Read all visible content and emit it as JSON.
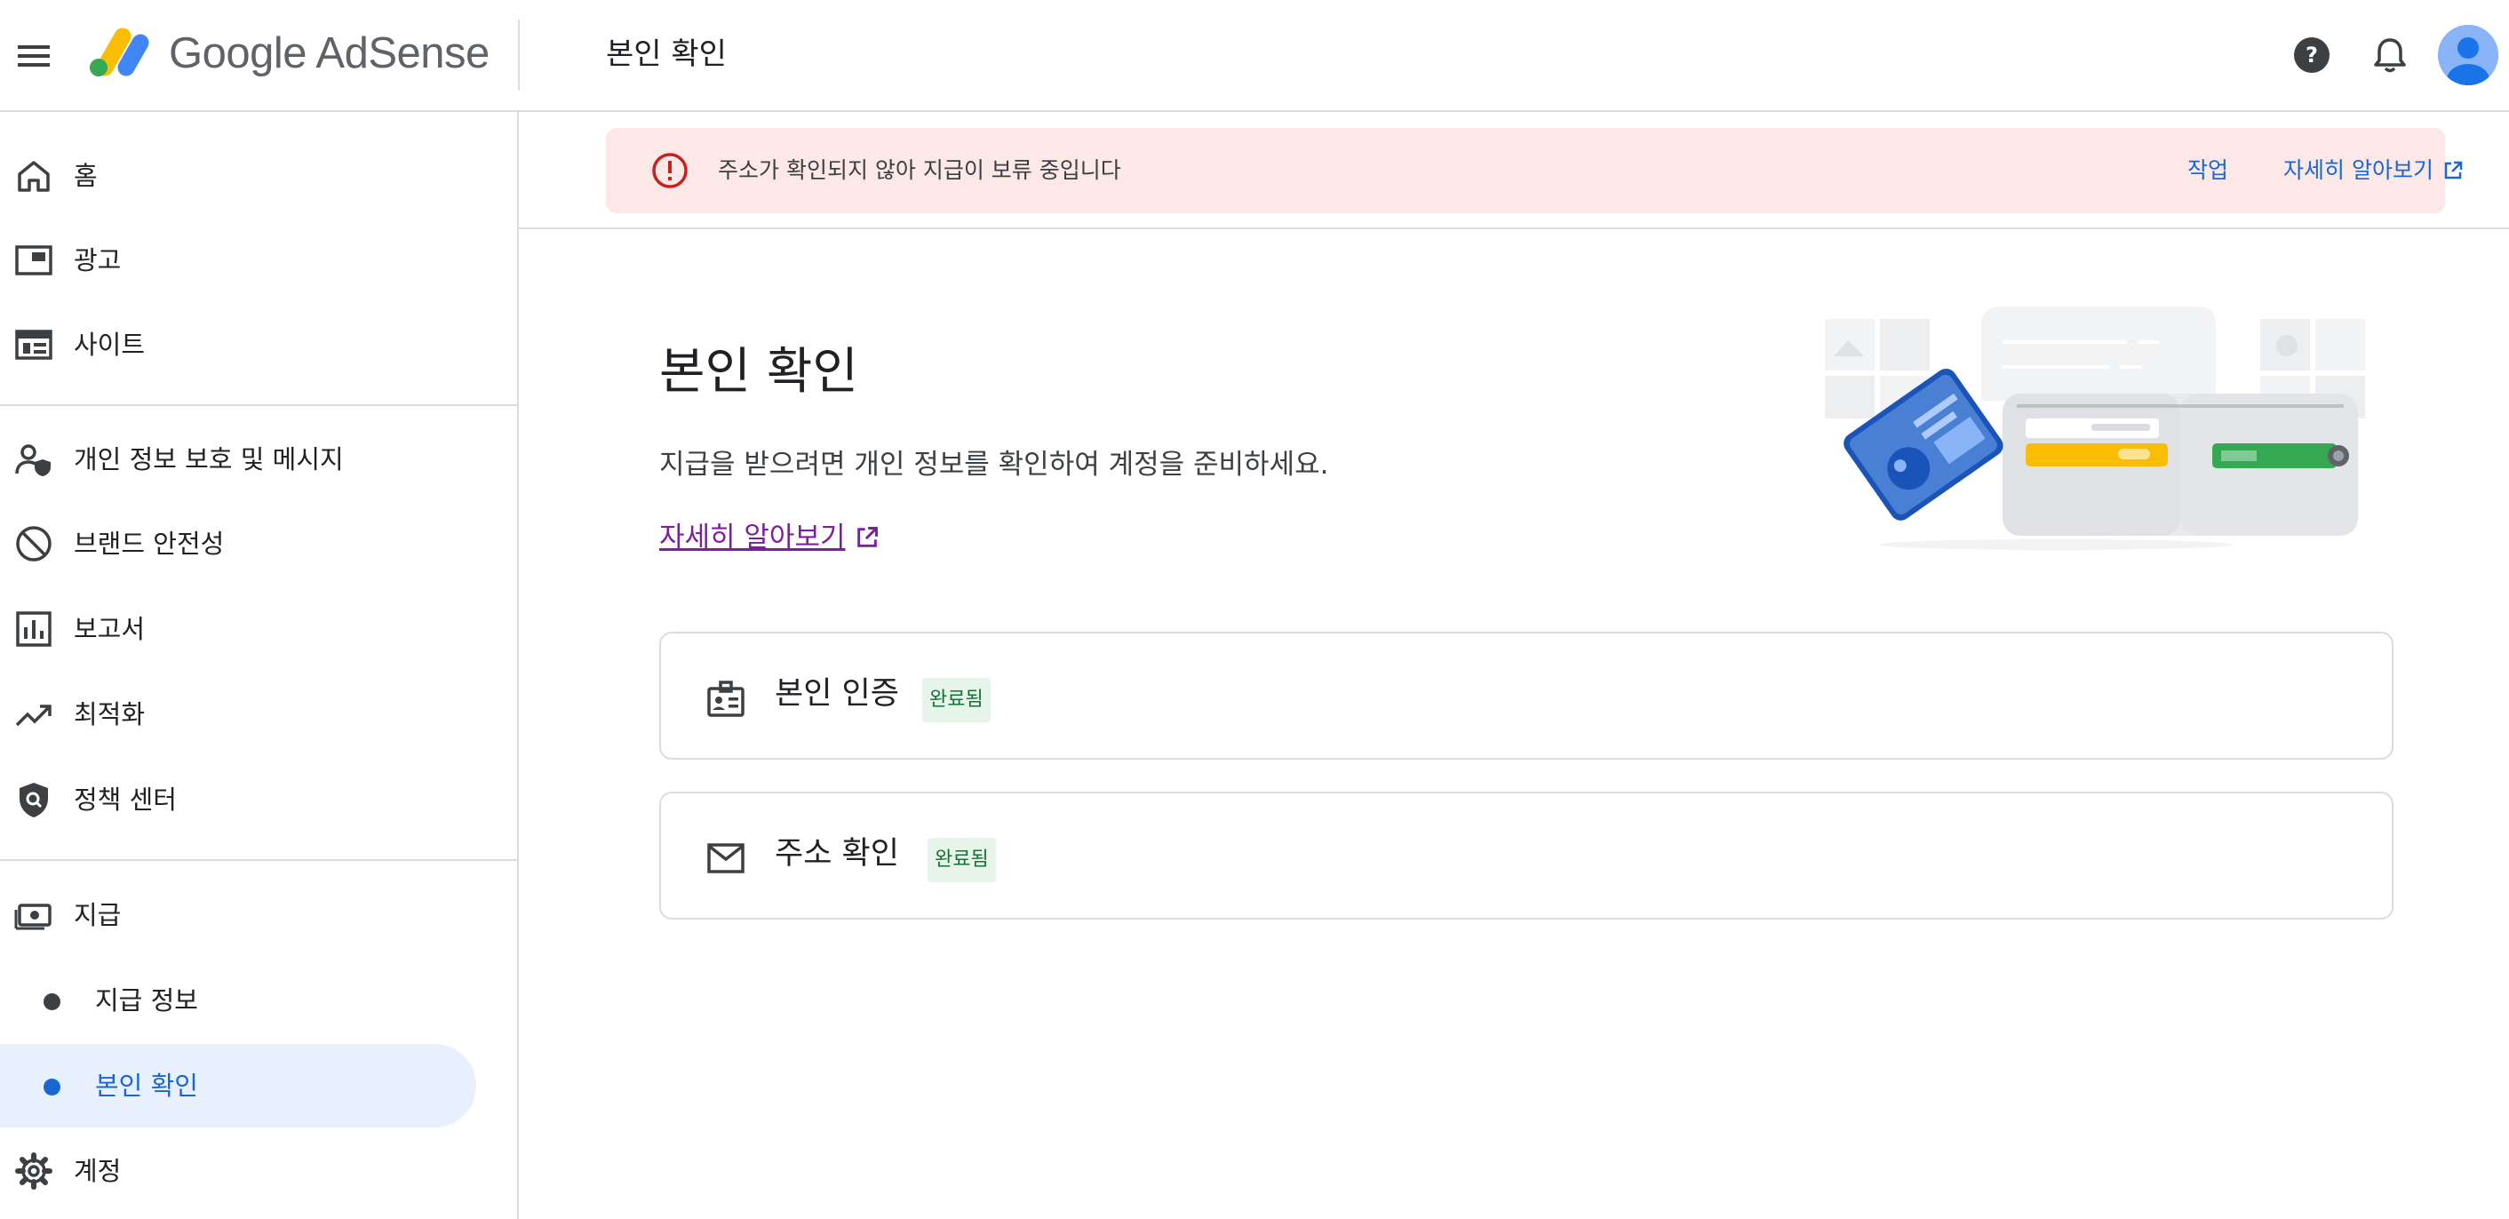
{
  "app": {
    "brand": "Google AdSense",
    "page_title": "본인 확인"
  },
  "header": {
    "menu_icon": "menu-icon",
    "help_icon": "help-circle-icon",
    "notifications_icon": "bell-icon",
    "avatar_icon": "account-avatar"
  },
  "sidebar": {
    "items": [
      {
        "label": "홈",
        "icon": "home-icon"
      },
      {
        "label": "광고",
        "icon": "ads-icon"
      },
      {
        "label": "사이트",
        "icon": "sites-icon"
      },
      {
        "label": "개인 정보 보호 및 메시지",
        "icon": "privacy-messaging-icon"
      },
      {
        "label": "브랜드 안전성",
        "icon": "block-icon"
      },
      {
        "label": "보고서",
        "icon": "bar-chart-icon"
      },
      {
        "label": "최적화",
        "icon": "trending-up-icon"
      },
      {
        "label": "정책 센터",
        "icon": "policy-shield-icon"
      },
      {
        "label": "지급",
        "icon": "payments-icon"
      },
      {
        "label": "지급 정보",
        "sub": true
      },
      {
        "label": "본인 확인",
        "sub": true,
        "active": true
      },
      {
        "label": "계정",
        "icon": "settings-icon"
      }
    ]
  },
  "alert": {
    "message": "주소가 확인되지 않아 지급이 보류 중입니다",
    "action_label": "작업",
    "learn_more_label": "자세히 알아보기",
    "icon": "error-icon"
  },
  "content": {
    "title": "본인 확인",
    "description": "지급을 받으려면 개인 정보를 확인하여 계정을 준비하세요.",
    "learn_more": "자세히 알아보기"
  },
  "cards": [
    {
      "label": "본인 인증",
      "status": "완료됨",
      "icon": "id-badge-icon"
    },
    {
      "label": "주소 확인",
      "status": "완료됨",
      "icon": "mail-icon"
    }
  ],
  "colors": {
    "accent": "#1967d2",
    "alert_bg": "#fce8e6",
    "alert_icon": "#c5221f",
    "badge_bg": "#e6f4ea",
    "badge_text": "#137333",
    "visited_link": "#7b1fa2",
    "active_nav_bg": "#e8f0fe"
  }
}
